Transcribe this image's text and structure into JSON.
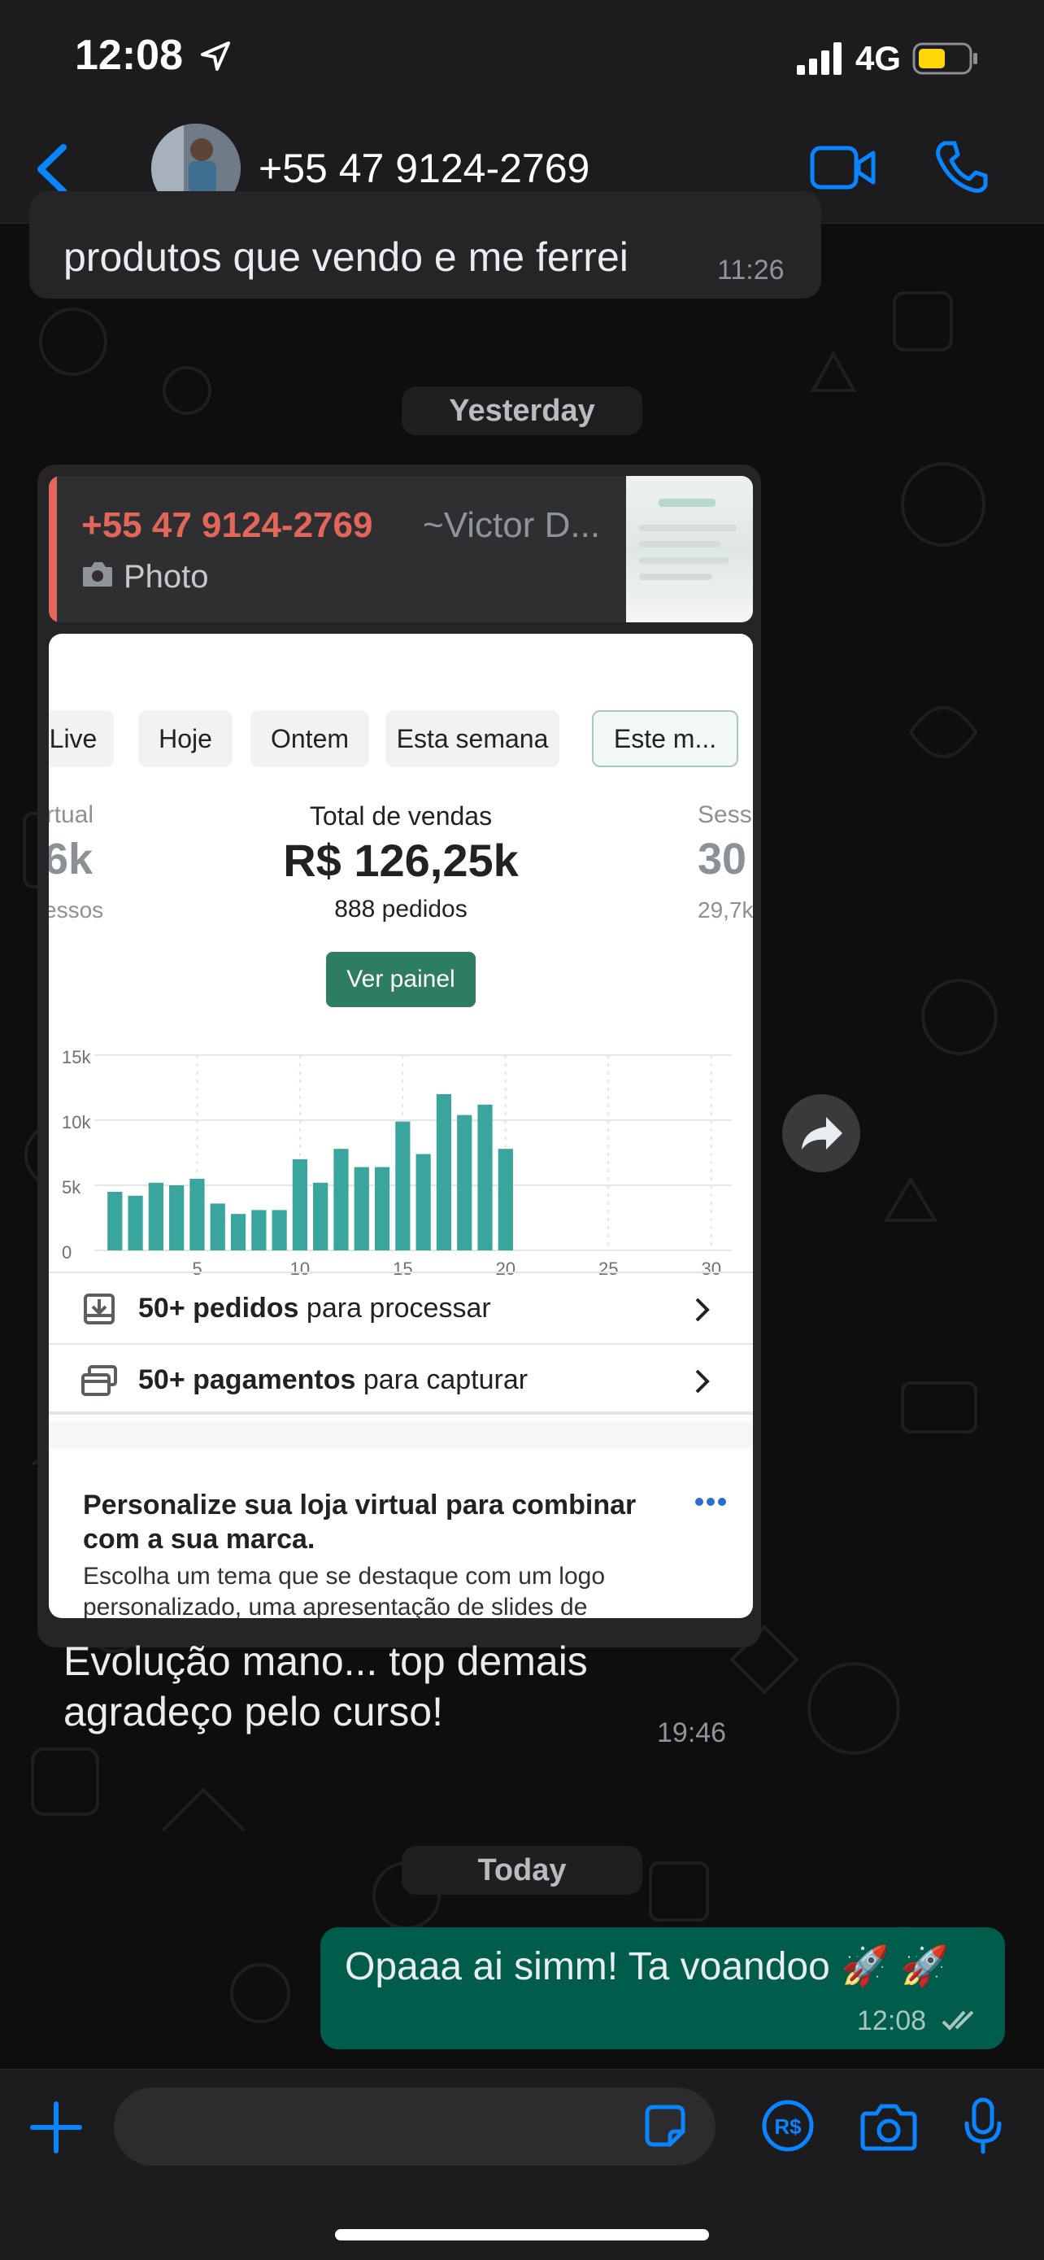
{
  "status_bar": {
    "time": "12:08",
    "network": "4G"
  },
  "header": {
    "contact_name": "+55 47 9124-2769"
  },
  "messages": {
    "partial": {
      "text": "produtos que vendo e me ferrei",
      "time": "11:26"
    },
    "yesterday_label": "Yesterday",
    "quote": {
      "number": "+55 47 9124-2769",
      "alias": "~Victor D...",
      "type": "Photo"
    },
    "shot": {
      "tabs": [
        "Live",
        "Hoje",
        "Ontem",
        "Esta semana",
        "Este m..."
      ],
      "left_label": "irtual",
      "left_value": "6k",
      "left_sub": "essos",
      "center_label": "Total de vendas",
      "center_value": "R$ 126,25k",
      "center_sub": "888 pedidos",
      "right_label": "Sess",
      "right_value": "30",
      "right_sub": "29,7k",
      "button": "Ver painel",
      "row1_bold": "50+ pedidos",
      "row1_rest": "para processar",
      "row2_bold": "50+ pagamentos",
      "row2_rest": "para capturar",
      "card_title": "Personalize sua loja virtual para combinar com a sua marca.",
      "card_body": "Escolha um tema que se destaque com um logo personalizado, uma apresentação de slides de produtos e muitas outras funcionalidades."
    },
    "caption": {
      "line1": "Evolução mano... top demais",
      "line2": "agradeço pelo curso!",
      "time": "19:46"
    },
    "today_label": "Today",
    "outgoing": {
      "text": "Opaaa ai simm! Ta voandoo 🚀 🚀",
      "time": "12:08"
    }
  },
  "chart_data": {
    "type": "bar",
    "x": [
      1,
      2,
      3,
      4,
      5,
      6,
      7,
      8,
      9,
      10,
      11,
      12,
      13,
      14,
      15,
      16,
      17,
      18,
      19,
      20
    ],
    "values": [
      4500,
      4200,
      5200,
      5000,
      5500,
      3600,
      2800,
      3100,
      3100,
      7000,
      5200,
      7800,
      6400,
      6400,
      9900,
      7400,
      12000,
      10400,
      11200,
      7800
    ],
    "x_ticks": [
      "5",
      "10",
      "15",
      "20",
      "25",
      "30"
    ],
    "y_ticks": [
      "0",
      "5k",
      "10k",
      "15k"
    ],
    "xlim": [
      0,
      31
    ],
    "ylim": [
      0,
      15000
    ],
    "grid": true,
    "colors": {
      "bar": "#3aa59c",
      "grid": "#e4e5e7"
    }
  },
  "colors": {
    "accent_blue": "#0a84ff",
    "outgoing_bubble": "#005c4b",
    "incoming_bubble": "#252527",
    "quote_accent": "#e3665b",
    "shopify_green": "#2e7d60"
  }
}
